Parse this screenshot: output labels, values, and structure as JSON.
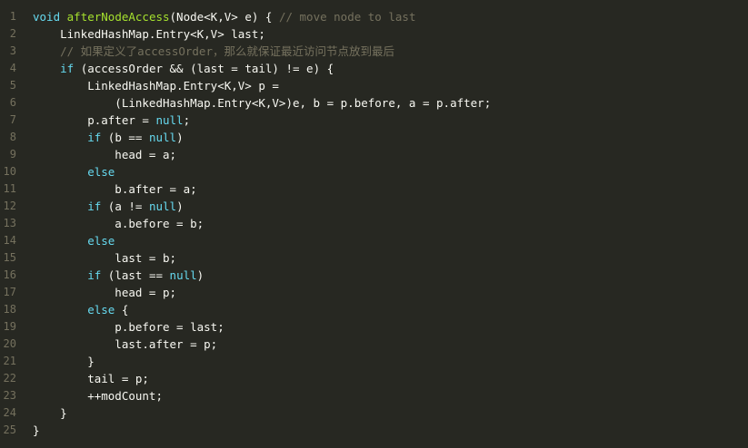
{
  "editor": {
    "lines": [
      {
        "n": "1",
        "tokens": [
          {
            "t": "void",
            "c": "kw"
          },
          {
            "t": " ",
            "c": ""
          },
          {
            "t": "afterNodeAccess",
            "c": "fn"
          },
          {
            "t": "(Node<K,V> e) { ",
            "c": ""
          },
          {
            "t": "// move node to last",
            "c": "cm"
          }
        ]
      },
      {
        "n": "2",
        "tokens": [
          {
            "t": "    LinkedHashMap.Entry<K,V> last;",
            "c": ""
          }
        ]
      },
      {
        "n": "3",
        "tokens": [
          {
            "t": "    ",
            "c": ""
          },
          {
            "t": "// 如果定义了accessOrder，那么就保证最近访问节点放到最后",
            "c": "cm"
          }
        ]
      },
      {
        "n": "4",
        "tokens": [
          {
            "t": "    ",
            "c": ""
          },
          {
            "t": "if",
            "c": "kw"
          },
          {
            "t": " (accessOrder && (last = tail) != e) {",
            "c": ""
          }
        ]
      },
      {
        "n": "5",
        "tokens": [
          {
            "t": "        LinkedHashMap.Entry<K,V> p =",
            "c": ""
          }
        ]
      },
      {
        "n": "6",
        "tokens": [
          {
            "t": "            (LinkedHashMap.Entry<K,V>)e, b = p.before, a = p.after;",
            "c": ""
          }
        ]
      },
      {
        "n": "7",
        "tokens": [
          {
            "t": "        p.after = ",
            "c": ""
          },
          {
            "t": "null",
            "c": "kw"
          },
          {
            "t": ";",
            "c": ""
          }
        ]
      },
      {
        "n": "8",
        "tokens": [
          {
            "t": "        ",
            "c": ""
          },
          {
            "t": "if",
            "c": "kw"
          },
          {
            "t": " (b == ",
            "c": ""
          },
          {
            "t": "null",
            "c": "kw"
          },
          {
            "t": ")",
            "c": ""
          }
        ]
      },
      {
        "n": "9",
        "tokens": [
          {
            "t": "            head = a;",
            "c": ""
          }
        ]
      },
      {
        "n": "10",
        "tokens": [
          {
            "t": "        ",
            "c": ""
          },
          {
            "t": "else",
            "c": "kw"
          }
        ]
      },
      {
        "n": "11",
        "tokens": [
          {
            "t": "            b.after = a;",
            "c": ""
          }
        ]
      },
      {
        "n": "12",
        "tokens": [
          {
            "t": "        ",
            "c": ""
          },
          {
            "t": "if",
            "c": "kw"
          },
          {
            "t": " (a != ",
            "c": ""
          },
          {
            "t": "null",
            "c": "kw"
          },
          {
            "t": ")",
            "c": ""
          }
        ]
      },
      {
        "n": "13",
        "tokens": [
          {
            "t": "            a.before = b;",
            "c": ""
          }
        ]
      },
      {
        "n": "14",
        "tokens": [
          {
            "t": "        ",
            "c": ""
          },
          {
            "t": "else",
            "c": "kw"
          }
        ]
      },
      {
        "n": "15",
        "tokens": [
          {
            "t": "            last = b;",
            "c": ""
          }
        ]
      },
      {
        "n": "16",
        "tokens": [
          {
            "t": "        ",
            "c": ""
          },
          {
            "t": "if",
            "c": "kw"
          },
          {
            "t": " (last == ",
            "c": ""
          },
          {
            "t": "null",
            "c": "kw"
          },
          {
            "t": ")",
            "c": ""
          }
        ]
      },
      {
        "n": "17",
        "tokens": [
          {
            "t": "            head = p;",
            "c": ""
          }
        ]
      },
      {
        "n": "18",
        "tokens": [
          {
            "t": "        ",
            "c": ""
          },
          {
            "t": "else",
            "c": "kw"
          },
          {
            "t": " {",
            "c": ""
          }
        ]
      },
      {
        "n": "19",
        "tokens": [
          {
            "t": "            p.before = last;",
            "c": ""
          }
        ]
      },
      {
        "n": "20",
        "tokens": [
          {
            "t": "            last.after = p;",
            "c": ""
          }
        ]
      },
      {
        "n": "21",
        "tokens": [
          {
            "t": "        }",
            "c": ""
          }
        ]
      },
      {
        "n": "22",
        "tokens": [
          {
            "t": "        tail = p;",
            "c": ""
          }
        ]
      },
      {
        "n": "23",
        "tokens": [
          {
            "t": "        ++modCount;",
            "c": ""
          }
        ]
      },
      {
        "n": "24",
        "tokens": [
          {
            "t": "    }",
            "c": ""
          }
        ]
      },
      {
        "n": "25",
        "tokens": [
          {
            "t": "}",
            "c": ""
          }
        ]
      }
    ]
  }
}
